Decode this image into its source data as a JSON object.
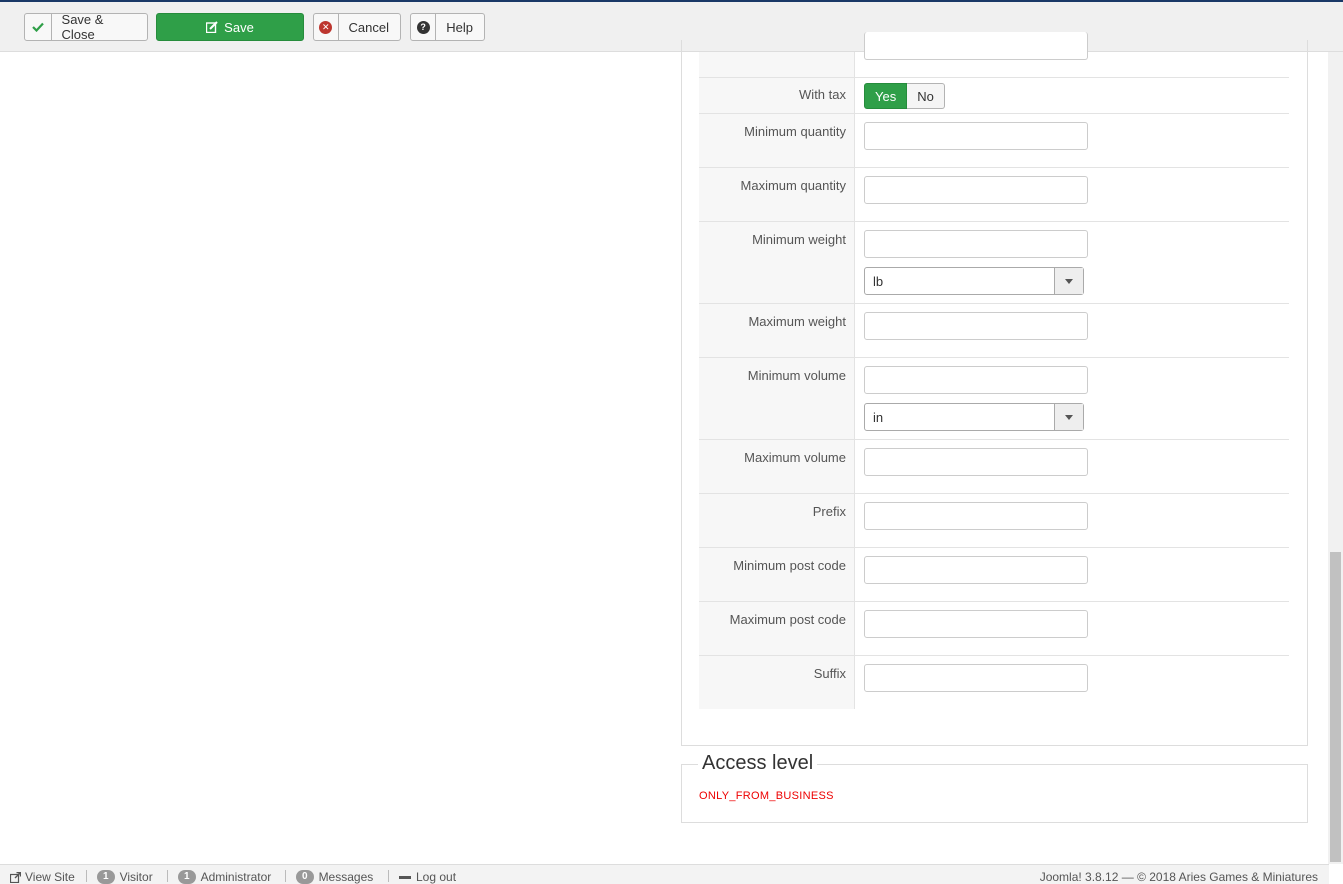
{
  "toolbar": {
    "save_close_label": "Save & Close",
    "save_label": "Save",
    "cancel_label": "Cancel",
    "help_label": "Help"
  },
  "fields": {
    "with_tax": {
      "label": "With tax",
      "yes": "Yes",
      "no": "No",
      "selected": "Yes"
    },
    "min_quantity": "Minimum quantity",
    "max_quantity": "Maximum quantity",
    "min_weight": "Minimum weight",
    "weight_unit": "lb",
    "max_weight": "Maximum weight",
    "min_volume": "Minimum volume",
    "volume_unit": "in",
    "max_volume": "Maximum volume",
    "prefix": "Prefix",
    "min_post_code": "Minimum post code",
    "max_post_code": "Maximum post code",
    "suffix": "Suffix"
  },
  "access": {
    "legend": "Access level",
    "value": "ONLY_FROM_BUSINESS"
  },
  "statusbar": {
    "view_site": "View Site",
    "visitor_count": "1",
    "visitor_label": "Visitor",
    "admin_count": "1",
    "admin_label": "Administrator",
    "messages_count": "0",
    "messages_label": "Messages",
    "logout": "Log out",
    "footer": "Joomla! 3.8.12  —  © 2018 Aries Games & Miniatures"
  },
  "colors": {
    "accent_green": "#2f9f48",
    "header_blue": "#1a3867",
    "error_red": "#e00000"
  },
  "icons": [
    "check-icon",
    "edit-icon",
    "cancel-icon",
    "question-icon",
    "external-link-icon",
    "minus-icon",
    "chevron-down-icon"
  ]
}
